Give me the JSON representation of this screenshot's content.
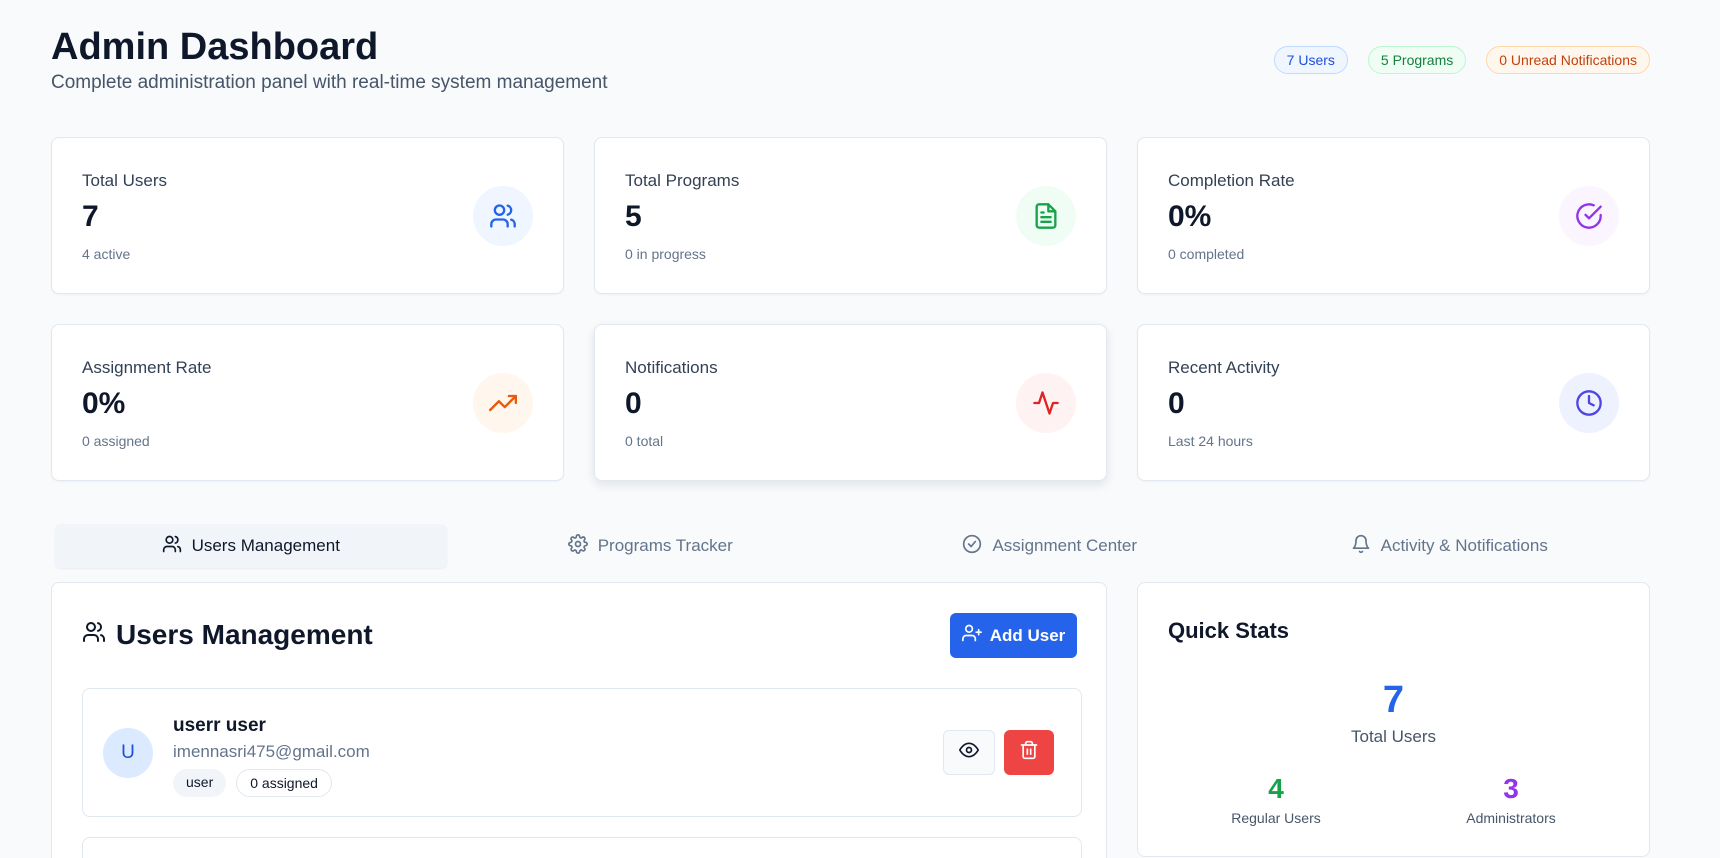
{
  "header": {
    "title": "Admin Dashboard",
    "subtitle": "Complete administration panel with real-time system management",
    "badges": [
      "7 Users",
      "5 Programs",
      "0 Unread Notifications"
    ]
  },
  "stats": [
    {
      "label": "Total Users",
      "value": "7",
      "sub": "4 active",
      "icon": "users-icon",
      "color": "#2563eb"
    },
    {
      "label": "Total Programs",
      "value": "5",
      "sub": "0 in progress",
      "icon": "file-text-icon",
      "color": "#16a34a"
    },
    {
      "label": "Completion Rate",
      "value": "0%",
      "sub": "0 completed",
      "icon": "check-circle-icon",
      "color": "#9333ea"
    },
    {
      "label": "Assignment Rate",
      "value": "0%",
      "sub": "0 assigned",
      "icon": "trending-up-icon",
      "color": "#ea580c"
    },
    {
      "label": "Notifications",
      "value": "0",
      "sub": "0 total",
      "icon": "activity-icon",
      "color": "#dc2626"
    },
    {
      "label": "Recent Activity",
      "value": "0",
      "sub": "Last 24 hours",
      "icon": "clock-icon",
      "color": "#4f46e5"
    }
  ],
  "tabs": [
    {
      "label": "Users Management",
      "icon": "users-icon",
      "active": true
    },
    {
      "label": "Programs Tracker",
      "icon": "gear-icon",
      "active": false
    },
    {
      "label": "Assignment Center",
      "icon": "check-circle-icon",
      "active": false
    },
    {
      "label": "Activity & Notifications",
      "icon": "bell-icon",
      "active": false
    }
  ],
  "users_panel": {
    "title": "Users Management",
    "add_label": "Add User",
    "users": [
      {
        "initial": "U",
        "name": "userr user",
        "email": "imennasri475@gmail.com",
        "role": "user",
        "assigned": "0 assigned"
      }
    ]
  },
  "quick_stats": {
    "title": "Quick Stats",
    "total_value": "7",
    "total_label": "Total Users",
    "regular_value": "4",
    "regular_label": "Regular Users",
    "admin_value": "3",
    "admin_label": "Administrators"
  },
  "colors": {
    "accent": "#2563eb",
    "danger": "#ef4444",
    "green": "#16a34a",
    "purple": "#9333ea"
  }
}
